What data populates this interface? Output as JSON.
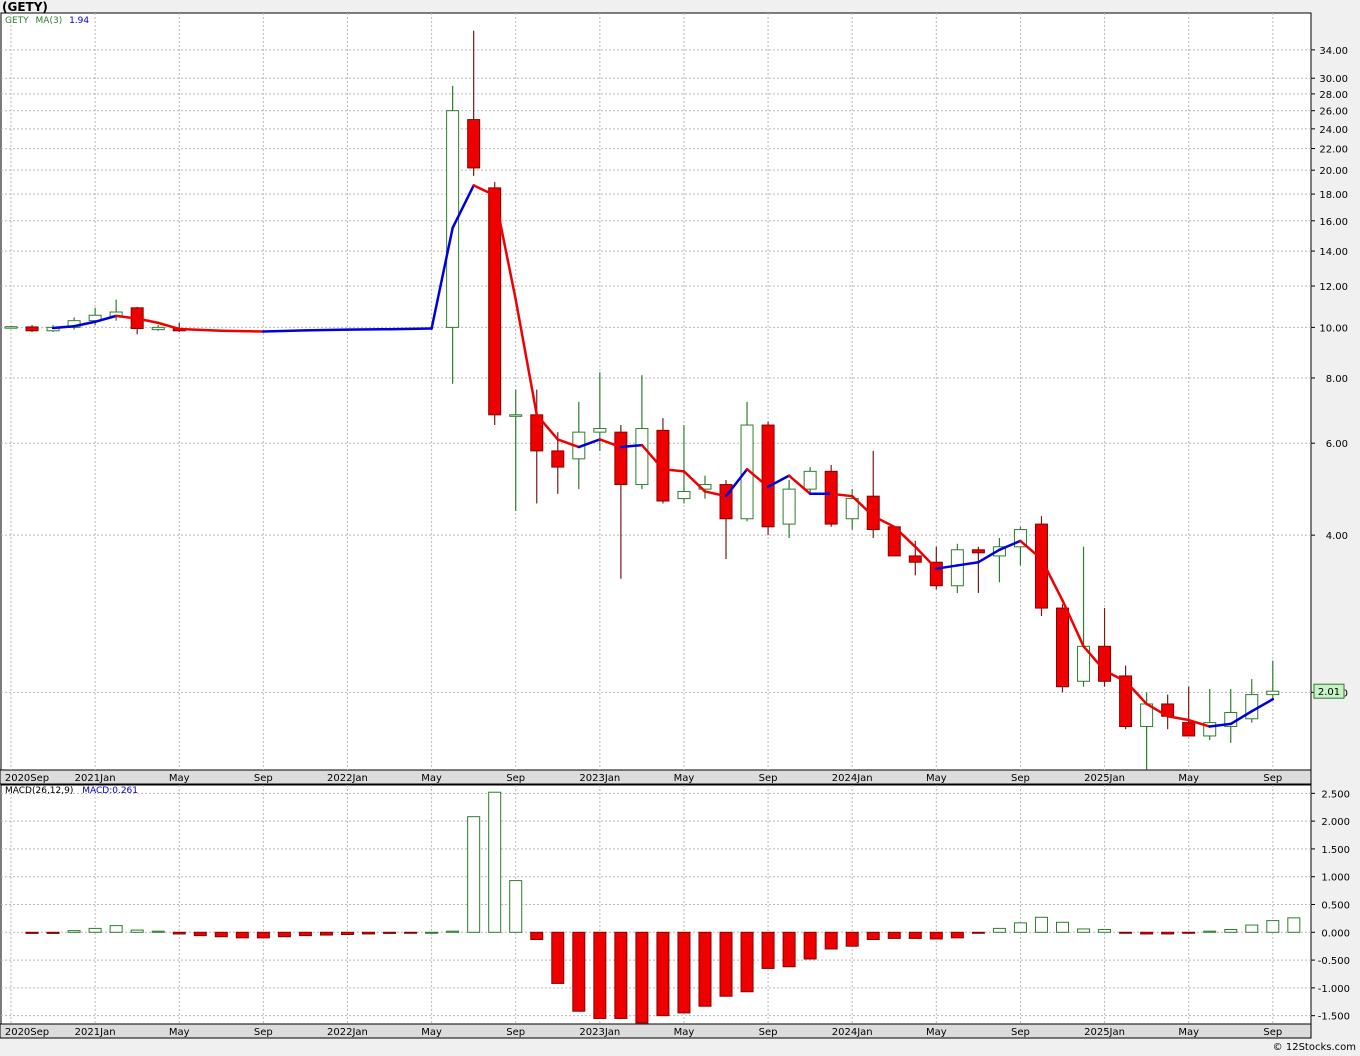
{
  "symbol_title": "(GETY)",
  "price_legend": {
    "symbol": "GETY",
    "ma_label": "MA(3)",
    "ma_value": "1.94"
  },
  "macd_legend": {
    "label": "MACD(26,12,9)",
    "value": "MACD:0.261"
  },
  "last_price_label": "2.01",
  "credit": "© 12Stocks.com",
  "colors": {
    "up": "#ffffff",
    "down": "#ee0000",
    "wick": "#2e7d2e",
    "ma_up": "#0000dd",
    "ma_down": "#ee0000",
    "grid": "#b8b8b8",
    "last_bg": "#c6f2c6"
  },
  "chart_data": [
    {
      "type": "candlestick",
      "title": "(GETY)",
      "y_scale": "log",
      "ylim": [
        1.42,
        40
      ],
      "y_ticks": [
        2.0,
        4.0,
        6.0,
        8.0,
        10.0,
        12.0,
        14.0,
        16.0,
        18.0,
        20.0,
        22.0,
        24.0,
        26.0,
        28.0,
        30.0,
        34.0
      ],
      "x_ticks": [
        "2020Sep",
        "2021Jan",
        "May",
        "Sep",
        "2022Jan",
        "May",
        "Sep",
        "2023Jan",
        "May",
        "Sep",
        "2024Jan",
        "May",
        "Sep",
        "2025Jan",
        "May",
        "Sep"
      ],
      "x_tick_months": [
        0,
        4,
        8,
        12,
        16,
        20,
        24,
        28,
        32,
        36,
        40,
        44,
        48,
        52,
        56,
        60
      ],
      "ohlc": [
        {
          "m": 0,
          "o": 10.02,
          "h": 10.06,
          "l": 9.98,
          "c": 10.03
        },
        {
          "m": 1,
          "o": 10.02,
          "h": 10.1,
          "l": 9.8,
          "c": 9.85
        },
        {
          "m": 2,
          "o": 9.85,
          "h": 10.1,
          "l": 9.8,
          "c": 10.0
        },
        {
          "m": 3,
          "o": 10.0,
          "h": 10.45,
          "l": 9.9,
          "c": 10.3
        },
        {
          "m": 4,
          "o": 10.3,
          "h": 10.9,
          "l": 10.1,
          "c": 10.55
        },
        {
          "m": 5,
          "o": 10.5,
          "h": 11.3,
          "l": 10.3,
          "c": 10.7
        },
        {
          "m": 6,
          "o": 10.9,
          "h": 10.95,
          "l": 9.7,
          "c": 9.95
        },
        {
          "m": 7,
          "o": 9.9,
          "h": 10.1,
          "l": 9.85,
          "c": 10.0
        },
        {
          "m": 8,
          "o": 9.95,
          "h": 10.2,
          "l": 9.8,
          "c": 9.85
        },
        {
          "m": 21,
          "o": 10.0,
          "h": 29.0,
          "l": 7.8,
          "c": 26.0
        },
        {
          "m": 22,
          "o": 25.0,
          "h": 37.0,
          "l": 19.5,
          "c": 20.2
        },
        {
          "m": 23,
          "o": 18.5,
          "h": 19.0,
          "l": 6.5,
          "c": 6.8
        },
        {
          "m": 24,
          "o": 6.8,
          "h": 7.6,
          "l": 4.45,
          "c": 6.8
        },
        {
          "m": 25,
          "o": 6.8,
          "h": 7.6,
          "l": 4.6,
          "c": 5.8
        },
        {
          "m": 26,
          "o": 5.8,
          "h": 6.3,
          "l": 4.8,
          "c": 5.4
        },
        {
          "m": 27,
          "o": 5.6,
          "h": 7.2,
          "l": 4.9,
          "c": 6.3
        },
        {
          "m": 28,
          "o": 6.3,
          "h": 8.2,
          "l": 5.8,
          "c": 6.4
        },
        {
          "m": 29,
          "o": 6.3,
          "h": 6.5,
          "l": 3.3,
          "c": 5.0
        },
        {
          "m": 30,
          "o": 5.0,
          "h": 8.1,
          "l": 4.9,
          "c": 6.4
        },
        {
          "m": 31,
          "o": 6.35,
          "h": 6.7,
          "l": 4.6,
          "c": 4.65
        },
        {
          "m": 32,
          "o": 4.7,
          "h": 6.5,
          "l": 4.6,
          "c": 4.85
        },
        {
          "m": 33,
          "o": 4.9,
          "h": 5.2,
          "l": 4.7,
          "c": 5.0
        },
        {
          "m": 34,
          "o": 5.0,
          "h": 5.1,
          "l": 3.6,
          "c": 4.3
        },
        {
          "m": 35,
          "o": 4.3,
          "h": 7.2,
          "l": 4.25,
          "c": 6.5
        },
        {
          "m": 36,
          "o": 6.5,
          "h": 6.6,
          "l": 4.0,
          "c": 4.15
        },
        {
          "m": 37,
          "o": 4.2,
          "h": 5.1,
          "l": 3.95,
          "c": 4.9
        },
        {
          "m": 38,
          "o": 4.9,
          "h": 5.4,
          "l": 4.8,
          "c": 5.3
        },
        {
          "m": 39,
          "o": 5.3,
          "h": 5.45,
          "l": 4.15,
          "c": 4.2
        },
        {
          "m": 40,
          "o": 4.3,
          "h": 4.9,
          "l": 4.1,
          "c": 4.7
        },
        {
          "m": 41,
          "o": 4.75,
          "h": 5.8,
          "l": 3.95,
          "c": 4.1
        },
        {
          "m": 42,
          "o": 4.15,
          "h": 4.15,
          "l": 3.65,
          "c": 3.65
        },
        {
          "m": 43,
          "o": 3.65,
          "h": 3.9,
          "l": 3.35,
          "c": 3.55
        },
        {
          "m": 44,
          "o": 3.55,
          "h": 3.8,
          "l": 3.15,
          "c": 3.2
        },
        {
          "m": 45,
          "o": 3.2,
          "h": 3.85,
          "l": 3.1,
          "c": 3.75
        },
        {
          "m": 46,
          "o": 3.75,
          "h": 3.8,
          "l": 3.1,
          "c": 3.7
        },
        {
          "m": 47,
          "o": 3.65,
          "h": 3.95,
          "l": 3.25,
          "c": 3.8
        },
        {
          "m": 48,
          "o": 3.8,
          "h": 4.15,
          "l": 3.5,
          "c": 4.1
        },
        {
          "m": 49,
          "o": 4.2,
          "h": 4.35,
          "l": 2.8,
          "c": 2.9
        },
        {
          "m": 50,
          "o": 2.9,
          "h": 2.95,
          "l": 2.0,
          "c": 2.05
        },
        {
          "m": 51,
          "o": 2.1,
          "h": 3.8,
          "l": 2.05,
          "c": 2.45
        },
        {
          "m": 52,
          "o": 2.45,
          "h": 2.9,
          "l": 2.05,
          "c": 2.1
        },
        {
          "m": 53,
          "o": 2.15,
          "h": 2.25,
          "l": 1.7,
          "c": 1.72
        },
        {
          "m": 54,
          "o": 1.72,
          "h": 2.0,
          "l": 1.42,
          "c": 1.9
        },
        {
          "m": 55,
          "o": 1.9,
          "h": 1.98,
          "l": 1.7,
          "c": 1.8
        },
        {
          "m": 56,
          "o": 1.75,
          "h": 2.05,
          "l": 1.65,
          "c": 1.65
        },
        {
          "m": 57,
          "o": 1.65,
          "h": 2.03,
          "l": 1.62,
          "c": 1.75
        },
        {
          "m": 58,
          "o": 1.72,
          "h": 2.03,
          "l": 1.6,
          "c": 1.83
        },
        {
          "m": 59,
          "o": 1.78,
          "h": 2.12,
          "l": 1.75,
          "c": 1.98
        },
        {
          "m": 60,
          "o": 1.98,
          "h": 2.3,
          "l": 1.95,
          "c": 2.01
        }
      ],
      "ma_series": {
        "name": "MA(3)",
        "points": [
          {
            "m": 2,
            "v": 9.97
          },
          {
            "m": 3,
            "v": 10.05
          },
          {
            "m": 4,
            "v": 10.25
          },
          {
            "m": 5,
            "v": 10.52
          },
          {
            "m": 6,
            "v": 10.4
          },
          {
            "m": 7,
            "v": 10.2
          },
          {
            "m": 8,
            "v": 9.93
          },
          {
            "m": 10,
            "v": 9.85
          },
          {
            "m": 12,
            "v": 9.82
          },
          {
            "m": 14,
            "v": 9.87
          },
          {
            "m": 16,
            "v": 9.9
          },
          {
            "m": 18,
            "v": 9.92
          },
          {
            "m": 20,
            "v": 9.95
          },
          {
            "m": 21,
            "v": 15.5
          },
          {
            "m": 22,
            "v": 18.7
          },
          {
            "m": 23,
            "v": 17.9
          },
          {
            "m": 24,
            "v": 11.3
          },
          {
            "m": 25,
            "v": 6.8
          },
          {
            "m": 26,
            "v": 6.1
          },
          {
            "m": 27,
            "v": 5.9
          },
          {
            "m": 28,
            "v": 6.1
          },
          {
            "m": 29,
            "v": 5.9
          },
          {
            "m": 30,
            "v": 5.95
          },
          {
            "m": 31,
            "v": 5.35
          },
          {
            "m": 32,
            "v": 5.3
          },
          {
            "m": 33,
            "v": 4.85
          },
          {
            "m": 34,
            "v": 4.75
          },
          {
            "m": 35,
            "v": 5.35
          },
          {
            "m": 36,
            "v": 4.95
          },
          {
            "m": 37,
            "v": 5.2
          },
          {
            "m": 38,
            "v": 4.8
          },
          {
            "m": 39,
            "v": 4.8
          },
          {
            "m": 40,
            "v": 4.75
          },
          {
            "m": 41,
            "v": 4.35
          },
          {
            "m": 42,
            "v": 4.15
          },
          {
            "m": 43,
            "v": 3.8
          },
          {
            "m": 44,
            "v": 3.45
          },
          {
            "m": 45,
            "v": 3.5
          },
          {
            "m": 46,
            "v": 3.55
          },
          {
            "m": 47,
            "v": 3.75
          },
          {
            "m": 48,
            "v": 3.9
          },
          {
            "m": 49,
            "v": 3.6
          },
          {
            "m": 50,
            "v": 3.0
          },
          {
            "m": 51,
            "v": 2.45
          },
          {
            "m": 52,
            "v": 2.2
          },
          {
            "m": 53,
            "v": 2.1
          },
          {
            "m": 54,
            "v": 1.9
          },
          {
            "m": 55,
            "v": 1.8
          },
          {
            "m": 56,
            "v": 1.77
          },
          {
            "m": 57,
            "v": 1.72
          },
          {
            "m": 58,
            "v": 1.74
          },
          {
            "m": 59,
            "v": 1.84
          },
          {
            "m": 60,
            "v": 1.94
          }
        ]
      }
    },
    {
      "type": "bar",
      "title": "MACD(26,12,9)",
      "ylim": [
        -1.65,
        2.65
      ],
      "y_ticks": [
        2.5,
        2.0,
        1.5,
        1.0,
        0.5,
        0.0,
        -0.5,
        -1.0,
        -1.5
      ],
      "y_tick_labels": [
        "2.500",
        "2.000",
        "1.500",
        "1.000",
        "0.500",
        "0.000",
        "-0.500",
        "-1.000",
        "-1.500"
      ],
      "x_ticks": [
        "2020Sep",
        "2021Jan",
        "May",
        "Sep",
        "2022Jan",
        "May",
        "Sep",
        "2023Jan",
        "May",
        "Sep",
        "2024Jan",
        "May",
        "Sep",
        "2025Jan",
        "May",
        "Sep"
      ],
      "bars": [
        {
          "m": 1,
          "v": -0.02
        },
        {
          "m": 2,
          "v": -0.02
        },
        {
          "m": 3,
          "v": 0.03
        },
        {
          "m": 4,
          "v": 0.07
        },
        {
          "m": 5,
          "v": 0.12
        },
        {
          "m": 6,
          "v": 0.04
        },
        {
          "m": 7,
          "v": 0.02
        },
        {
          "m": 8,
          "v": -0.03
        },
        {
          "m": 9,
          "v": -0.06
        },
        {
          "m": 10,
          "v": -0.08
        },
        {
          "m": 11,
          "v": -0.1
        },
        {
          "m": 12,
          "v": -0.1
        },
        {
          "m": 13,
          "v": -0.08
        },
        {
          "m": 14,
          "v": -0.06
        },
        {
          "m": 15,
          "v": -0.05
        },
        {
          "m": 16,
          "v": -0.04
        },
        {
          "m": 17,
          "v": -0.03
        },
        {
          "m": 18,
          "v": -0.02
        },
        {
          "m": 19,
          "v": -0.01
        },
        {
          "m": 20,
          "v": 0.0
        },
        {
          "m": 21,
          "v": 0.02
        },
        {
          "m": 22,
          "v": 2.08
        },
        {
          "m": 23,
          "v": 2.52
        },
        {
          "m": 24,
          "v": 0.93
        },
        {
          "m": 25,
          "v": -0.13
        },
        {
          "m": 26,
          "v": -0.92
        },
        {
          "m": 27,
          "v": -1.42
        },
        {
          "m": 28,
          "v": -1.55
        },
        {
          "m": 29,
          "v": -1.55
        },
        {
          "m": 30,
          "v": -1.63
        },
        {
          "m": 31,
          "v": -1.5
        },
        {
          "m": 32,
          "v": -1.45
        },
        {
          "m": 33,
          "v": -1.33
        },
        {
          "m": 34,
          "v": -1.15
        },
        {
          "m": 35,
          "v": -1.07
        },
        {
          "m": 36,
          "v": -0.65
        },
        {
          "m": 37,
          "v": -0.62
        },
        {
          "m": 38,
          "v": -0.48
        },
        {
          "m": 39,
          "v": -0.3
        },
        {
          "m": 40,
          "v": -0.25
        },
        {
          "m": 41,
          "v": -0.13
        },
        {
          "m": 42,
          "v": -0.11
        },
        {
          "m": 43,
          "v": -0.11
        },
        {
          "m": 44,
          "v": -0.12
        },
        {
          "m": 45,
          "v": -0.1
        },
        {
          "m": 46,
          "v": -0.01
        },
        {
          "m": 47,
          "v": 0.07
        },
        {
          "m": 48,
          "v": 0.17
        },
        {
          "m": 49,
          "v": 0.27
        },
        {
          "m": 50,
          "v": 0.18
        },
        {
          "m": 51,
          "v": 0.06
        },
        {
          "m": 52,
          "v": 0.05
        },
        {
          "m": 53,
          "v": -0.01
        },
        {
          "m": 54,
          "v": -0.03
        },
        {
          "m": 55,
          "v": -0.03
        },
        {
          "m": 56,
          "v": -0.01
        },
        {
          "m": 57,
          "v": 0.02
        },
        {
          "m": 58,
          "v": 0.05
        },
        {
          "m": 59,
          "v": 0.13
        },
        {
          "m": 60,
          "v": 0.21
        },
        {
          "m": 61,
          "v": 0.26
        }
      ]
    }
  ]
}
